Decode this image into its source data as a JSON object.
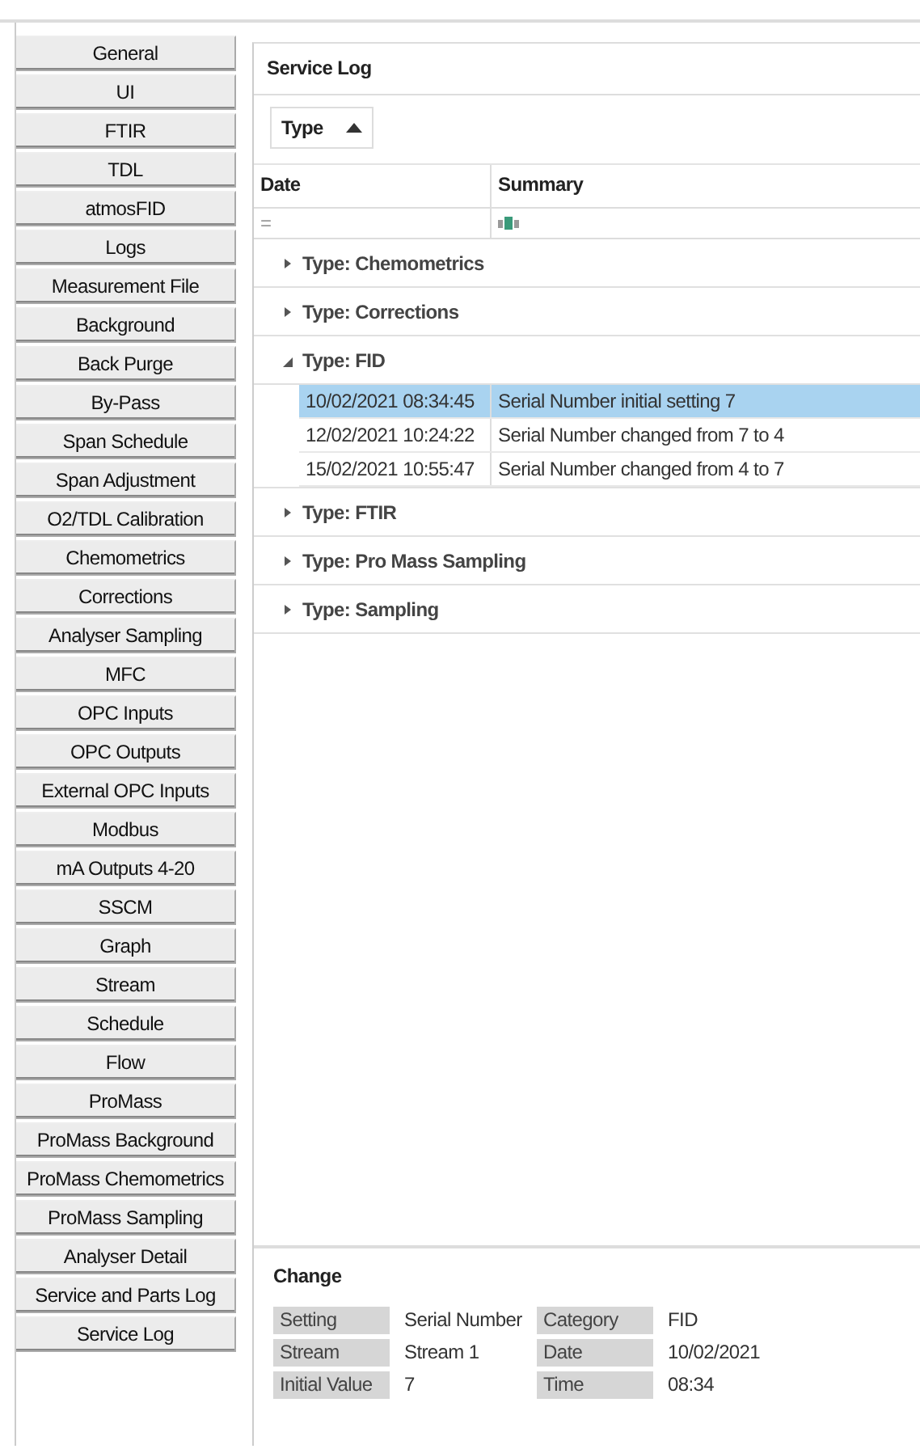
{
  "sidebar": {
    "items": [
      {
        "label": "General"
      },
      {
        "label": "UI"
      },
      {
        "label": "FTIR"
      },
      {
        "label": "TDL"
      },
      {
        "label": "atmosFID"
      },
      {
        "label": "Logs"
      },
      {
        "label": "Measurement File"
      },
      {
        "label": "Background"
      },
      {
        "label": "Back Purge"
      },
      {
        "label": "By-Pass"
      },
      {
        "label": "Span Schedule"
      },
      {
        "label": "Span Adjustment"
      },
      {
        "label": "O2/TDL Calibration"
      },
      {
        "label": "Chemometrics"
      },
      {
        "label": "Corrections"
      },
      {
        "label": "Analyser Sampling"
      },
      {
        "label": "MFC"
      },
      {
        "label": "OPC Inputs"
      },
      {
        "label": "OPC Outputs"
      },
      {
        "label": "External OPC Inputs"
      },
      {
        "label": "Modbus"
      },
      {
        "label": "mA Outputs 4-20"
      },
      {
        "label": "SSCM"
      },
      {
        "label": "Graph"
      },
      {
        "label": "Stream"
      },
      {
        "label": "Schedule"
      },
      {
        "label": "Flow"
      },
      {
        "label": "ProMass"
      },
      {
        "label": "ProMass Background"
      },
      {
        "label": "ProMass Chemometrics"
      },
      {
        "label": "ProMass Sampling"
      },
      {
        "label": "Analyser Detail"
      },
      {
        "label": "Service and Parts Log"
      },
      {
        "label": "Service Log"
      }
    ]
  },
  "panel": {
    "title": "Service Log",
    "group_by": {
      "label": "Type",
      "descending": false
    },
    "table": {
      "columns": [
        "Date",
        "Summary"
      ],
      "filter_row": {
        "column_1": "="
      },
      "groups": [
        {
          "label": "Type: Chemometrics",
          "expanded": false
        },
        {
          "label": "Type: Corrections",
          "expanded": false
        },
        {
          "label": "Type: FID",
          "expanded": true,
          "rows": [
            {
              "date": "10/02/2021 08:34:45",
              "summary": "Serial Number initial setting 7",
              "selected": true
            },
            {
              "date": "12/02/2021 10:24:22",
              "summary": "Serial Number changed from 7 to 4",
              "selected": false
            },
            {
              "date": "15/02/2021 10:55:47",
              "summary": "Serial Number changed from 4 to 7",
              "selected": false
            }
          ]
        },
        {
          "label": "Type: FTIR",
          "expanded": false
        },
        {
          "label": "Type: Pro Mass Sampling",
          "expanded": false
        },
        {
          "label": "Type: Sampling",
          "expanded": false
        }
      ]
    }
  },
  "change": {
    "title": "Change",
    "fields": [
      {
        "label": "Setting",
        "value": "Serial Number"
      },
      {
        "label": "Category",
        "value": "FID"
      },
      {
        "label": "Stream",
        "value": "Stream 1"
      },
      {
        "label": "Date",
        "value": "10/02/2021"
      },
      {
        "label": "Initial Value",
        "value": "7"
      },
      {
        "label": "Time",
        "value": "08:34"
      }
    ]
  }
}
